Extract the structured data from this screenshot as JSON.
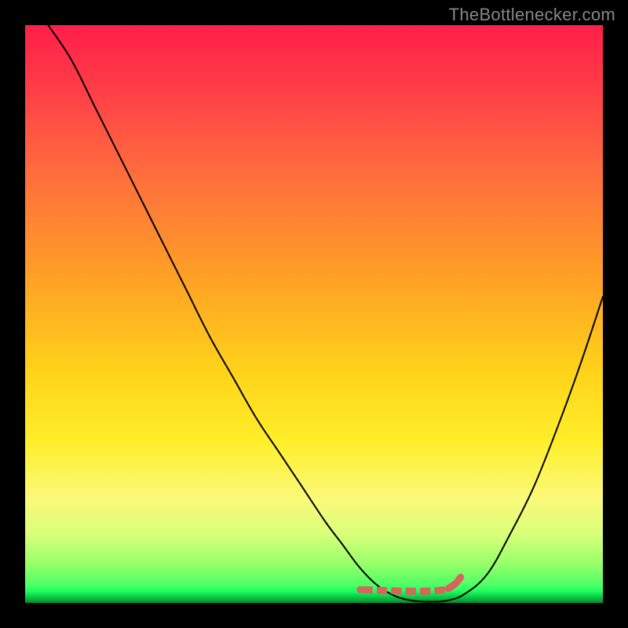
{
  "branding": {
    "text": "TheBottlenecker.com"
  },
  "chart_data": {
    "type": "line",
    "title": "",
    "xlabel": "",
    "ylabel": "",
    "x_range": [
      0,
      100
    ],
    "y_range": [
      0,
      100
    ],
    "gradient_colors": {
      "top": "#ff1f4a",
      "mid_upper": "#ff6b3e",
      "mid": "#ffd31a",
      "mid_lower": "#d9ff7a",
      "bottom": "#008f2e"
    },
    "series": [
      {
        "name": "bottleneck-curve",
        "color": "#000000",
        "stroke_width": 2,
        "x": [
          4,
          8,
          12,
          16,
          20,
          24,
          28,
          32,
          36,
          40,
          44,
          48,
          52,
          55,
          58,
          61,
          64,
          67,
          70,
          73,
          76,
          80,
          84,
          88,
          92,
          96,
          100
        ],
        "y": [
          100,
          94,
          86,
          78,
          70,
          62,
          54,
          46,
          39,
          32,
          26,
          20,
          14,
          10,
          6,
          3,
          1.2,
          0.4,
          0.2,
          0.4,
          1.5,
          5,
          12,
          20,
          30,
          41,
          53
        ]
      },
      {
        "name": "optimal-region-marker",
        "color": "#d6655e",
        "stroke_width": 9,
        "shape": "segmented-dots",
        "x": [
          58,
          60.5,
          63,
          65.5,
          68,
          70.5,
          73,
          74.6,
          75.5
        ],
        "y": [
          2.3,
          2.2,
          2.1,
          2.05,
          2.0,
          2.05,
          2.3,
          3.4,
          4.6
        ]
      }
    ],
    "annotations": []
  }
}
